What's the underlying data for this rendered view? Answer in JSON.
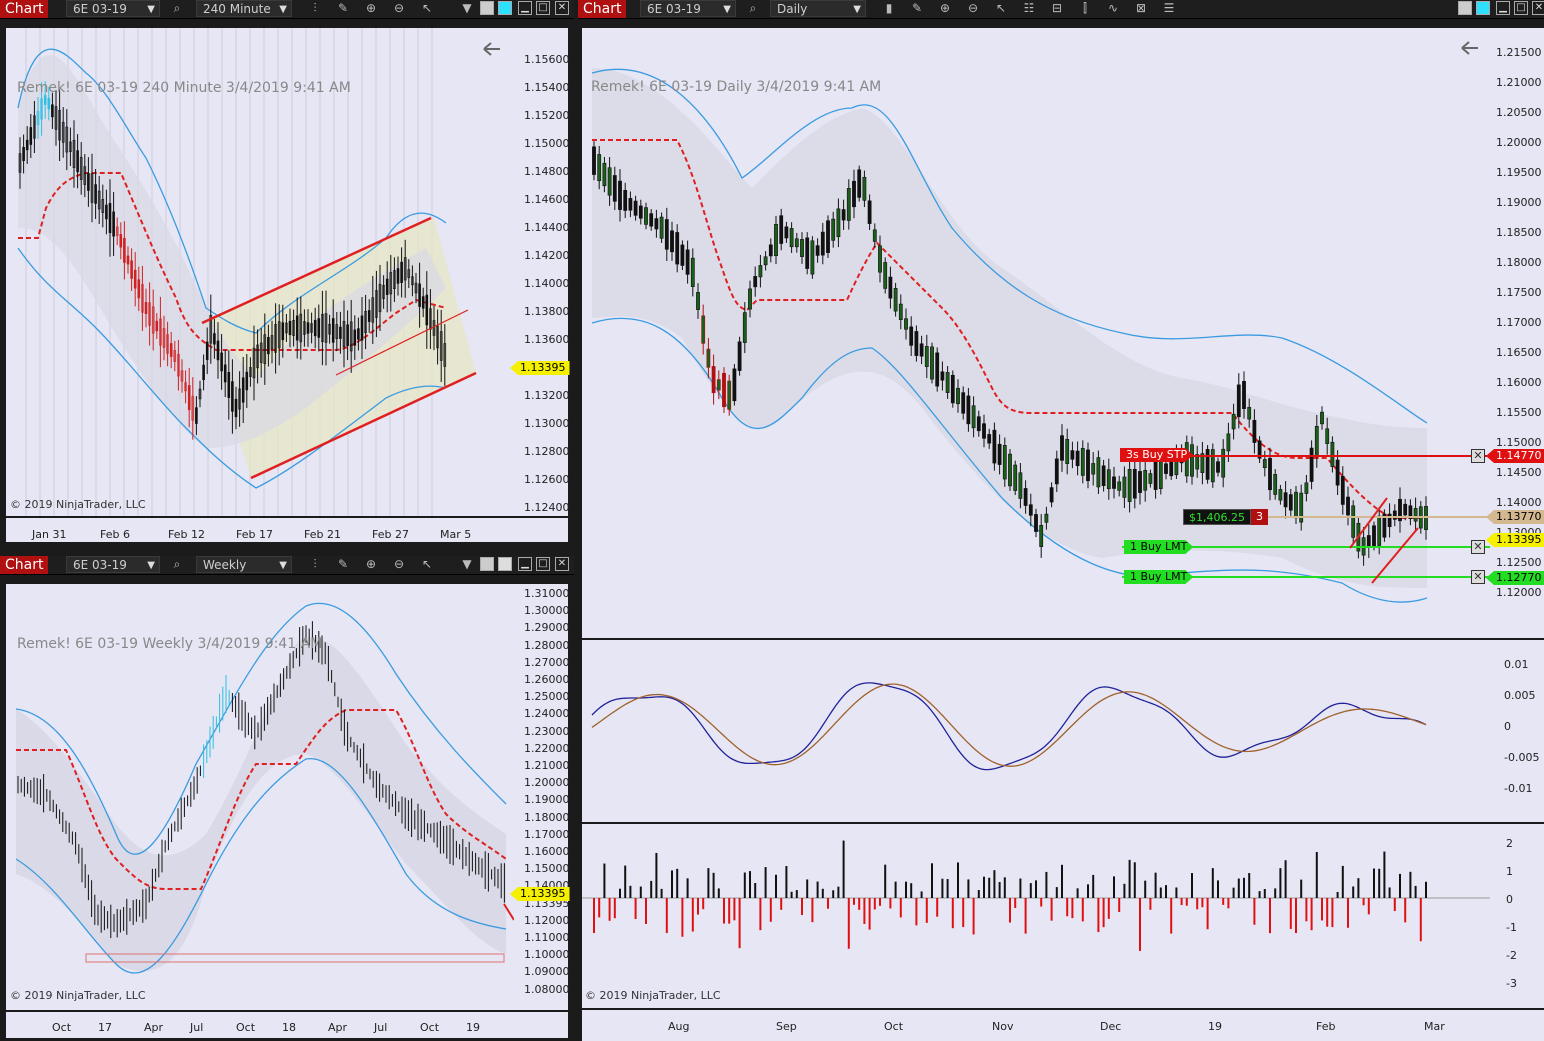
{
  "windows": {
    "top_left": {
      "chart_button": "Chart",
      "instrument": "6E 03-19",
      "interval": "240 Minute",
      "title": "Remek!  6E 03-19  240 Minute  3/4/2019 9:41 AM",
      "copyright": "© 2019 NinjaTrader, LLC",
      "price_ticks": [
        "1.15600",
        "1.15400",
        "1.15200",
        "1.15000",
        "1.14800",
        "1.14600",
        "1.14400",
        "1.14200",
        "1.14000",
        "1.13800",
        "1.13600",
        "1.13395",
        "1.13200",
        "1.13000",
        "1.12800",
        "1.12600",
        "1.12400"
      ],
      "last_price": "1.13395",
      "date_ticks": [
        "Jan 31",
        "Feb 6",
        "Feb 12",
        "Feb 17",
        "Feb 21",
        "Feb 27",
        "Mar 5"
      ]
    },
    "bottom_left": {
      "chart_button": "Chart",
      "instrument": "6E 03-19",
      "interval": "Weekly",
      "title": "Remek!  6E 03-19  Weekly  3/4/2019 9:41 AM",
      "copyright": "© 2019 NinjaTrader, LLC",
      "price_ticks": [
        "1.31000",
        "1.30000",
        "1.29000",
        "1.28000",
        "1.27000",
        "1.26000",
        "1.25000",
        "1.24000",
        "1.23000",
        "1.22000",
        "1.21000",
        "1.20000",
        "1.19000",
        "1.18000",
        "1.17000",
        "1.16000",
        "1.15000",
        "1.14000",
        "1.13395",
        "1.12000",
        "1.11000",
        "1.10000",
        "1.09000",
        "1.08000"
      ],
      "last_price": "1.13395",
      "date_ticks": [
        "Oct",
        "17",
        "Apr",
        "Jul",
        "Oct",
        "18",
        "Apr",
        "Jul",
        "Oct",
        "19"
      ]
    },
    "right": {
      "chart_button": "Chart",
      "instrument": "6E 03-19",
      "interval": "Daily",
      "title": "Remek!  6E 03-19  Daily  3/4/2019 9:41 AM",
      "copyright": "© 2019 NinjaTrader, LLC",
      "price_ticks": [
        "1.21500",
        "1.21000",
        "1.20500",
        "1.20000",
        "1.19500",
        "1.19000",
        "1.18500",
        "1.18000",
        "1.17500",
        "1.17000",
        "1.16500",
        "1.16000",
        "1.15500",
        "1.15000",
        "1.14500",
        "1.14000",
        "1.13000",
        "1.12500",
        "1.12000"
      ],
      "stop_price": "1.14770",
      "position_price": "1.13770",
      "last_price": "1.13395",
      "limit_price": "1.12770",
      "orders": {
        "stop_label": "3s  Buy STP",
        "pnl_label": "$1,406.25",
        "pnl_qty": "3",
        "limit1_label": "1   Buy LMT",
        "limit2_label": "1   Buy LMT"
      },
      "osc_ticks": [
        "0.01",
        "0.005",
        "0",
        "-0.005",
        "-0.01"
      ],
      "hist_ticks": [
        "2",
        "1",
        "0",
        "-1",
        "-2",
        "-3"
      ],
      "date_ticks": [
        "Aug",
        "Sep",
        "Oct",
        "Nov",
        "Dec",
        "19",
        "Feb",
        "Mar"
      ]
    }
  },
  "colors": {
    "chart_bg": "#e6e6f5",
    "band": "#3a9be0",
    "trend_down": "#e02020",
    "trend_up": "#4a63d8",
    "neutral": "#f5f000",
    "stop": "#e01010",
    "limit": "#22dd22",
    "position": "#d4b890",
    "osc_fast": "#22229a",
    "osc_slow": "#a0622a"
  }
}
